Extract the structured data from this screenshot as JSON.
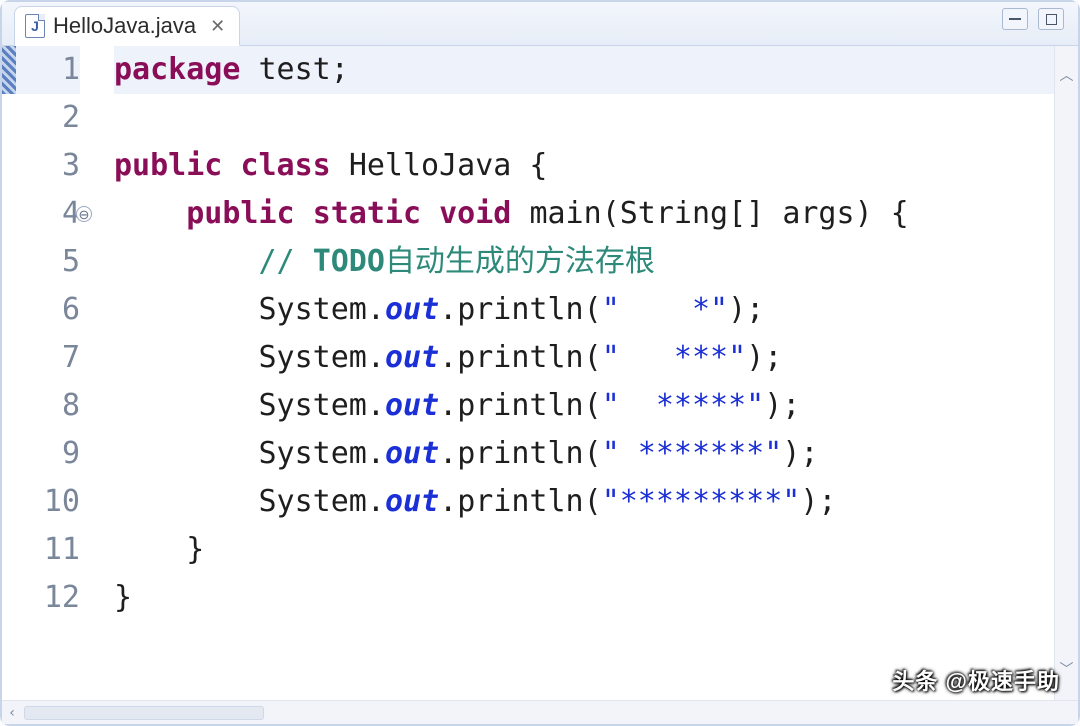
{
  "tab": {
    "filename": "HelloJava.java",
    "icon_letter": "J",
    "close_glyph": "✕"
  },
  "window_controls": {
    "minimize": "minimize",
    "maximize": "maximize"
  },
  "editor": {
    "current_line": 1,
    "fold_marker_line": 4,
    "fold_glyph": "⊖",
    "lines": [
      {
        "n": 1,
        "tokens": [
          {
            "t": "package",
            "c": "kw"
          },
          {
            "t": " ",
            "c": ""
          },
          {
            "t": "test",
            "c": "cls"
          },
          {
            "t": ";",
            "c": "punc"
          }
        ]
      },
      {
        "n": 2,
        "tokens": []
      },
      {
        "n": 3,
        "tokens": [
          {
            "t": "public",
            "c": "kw"
          },
          {
            "t": " ",
            "c": ""
          },
          {
            "t": "class",
            "c": "kw"
          },
          {
            "t": " ",
            "c": ""
          },
          {
            "t": "HelloJava",
            "c": "cls"
          },
          {
            "t": " {",
            "c": "punc"
          }
        ]
      },
      {
        "n": 4,
        "tokens": [
          {
            "t": "    ",
            "c": ""
          },
          {
            "t": "public",
            "c": "kw"
          },
          {
            "t": " ",
            "c": ""
          },
          {
            "t": "static",
            "c": "kw"
          },
          {
            "t": " ",
            "c": ""
          },
          {
            "t": "void",
            "c": "type"
          },
          {
            "t": " ",
            "c": ""
          },
          {
            "t": "main",
            "c": "cls"
          },
          {
            "t": "(",
            "c": "punc"
          },
          {
            "t": "String",
            "c": "cls"
          },
          {
            "t": "[] ",
            "c": "punc"
          },
          {
            "t": "args",
            "c": "cls"
          },
          {
            "t": ") {",
            "c": "punc"
          }
        ]
      },
      {
        "n": 5,
        "tokens": [
          {
            "t": "        ",
            "c": ""
          },
          {
            "t": "// ",
            "c": "cmt"
          },
          {
            "t": "TODO",
            "c": "todo"
          },
          {
            "t": "自动生成的方法存根",
            "c": "cmt"
          }
        ]
      },
      {
        "n": 6,
        "tokens": [
          {
            "t": "        ",
            "c": ""
          },
          {
            "t": "System",
            "c": "cls"
          },
          {
            "t": ".",
            "c": "punc"
          },
          {
            "t": "out",
            "c": "field"
          },
          {
            "t": ".",
            "c": "punc"
          },
          {
            "t": "println",
            "c": "cls"
          },
          {
            "t": "(",
            "c": "punc"
          },
          {
            "t": "\"    *\"",
            "c": "str"
          },
          {
            "t": ");",
            "c": "punc"
          }
        ]
      },
      {
        "n": 7,
        "tokens": [
          {
            "t": "        ",
            "c": ""
          },
          {
            "t": "System",
            "c": "cls"
          },
          {
            "t": ".",
            "c": "punc"
          },
          {
            "t": "out",
            "c": "field"
          },
          {
            "t": ".",
            "c": "punc"
          },
          {
            "t": "println",
            "c": "cls"
          },
          {
            "t": "(",
            "c": "punc"
          },
          {
            "t": "\"   ***\"",
            "c": "str"
          },
          {
            "t": ");",
            "c": "punc"
          }
        ]
      },
      {
        "n": 8,
        "tokens": [
          {
            "t": "        ",
            "c": ""
          },
          {
            "t": "System",
            "c": "cls"
          },
          {
            "t": ".",
            "c": "punc"
          },
          {
            "t": "out",
            "c": "field"
          },
          {
            "t": ".",
            "c": "punc"
          },
          {
            "t": "println",
            "c": "cls"
          },
          {
            "t": "(",
            "c": "punc"
          },
          {
            "t": "\"  *****\"",
            "c": "str"
          },
          {
            "t": ");",
            "c": "punc"
          }
        ]
      },
      {
        "n": 9,
        "tokens": [
          {
            "t": "        ",
            "c": ""
          },
          {
            "t": "System",
            "c": "cls"
          },
          {
            "t": ".",
            "c": "punc"
          },
          {
            "t": "out",
            "c": "field"
          },
          {
            "t": ".",
            "c": "punc"
          },
          {
            "t": "println",
            "c": "cls"
          },
          {
            "t": "(",
            "c": "punc"
          },
          {
            "t": "\" *******\"",
            "c": "str"
          },
          {
            "t": ");",
            "c": "punc"
          }
        ]
      },
      {
        "n": 10,
        "tokens": [
          {
            "t": "        ",
            "c": ""
          },
          {
            "t": "System",
            "c": "cls"
          },
          {
            "t": ".",
            "c": "punc"
          },
          {
            "t": "out",
            "c": "field"
          },
          {
            "t": ".",
            "c": "punc"
          },
          {
            "t": "println",
            "c": "cls"
          },
          {
            "t": "(",
            "c": "punc"
          },
          {
            "t": "\"*********\"",
            "c": "str"
          },
          {
            "t": ");",
            "c": "punc"
          }
        ]
      },
      {
        "n": 11,
        "tokens": [
          {
            "t": "    }",
            "c": "punc"
          }
        ]
      },
      {
        "n": 12,
        "tokens": [
          {
            "t": "}",
            "c": "punc"
          }
        ]
      }
    ]
  },
  "scroll": {
    "up_glyph": "︿",
    "down_glyph": "﹀",
    "left_glyph": "‹",
    "right_glyph": "›"
  },
  "watermark": "头条 @极速手助"
}
